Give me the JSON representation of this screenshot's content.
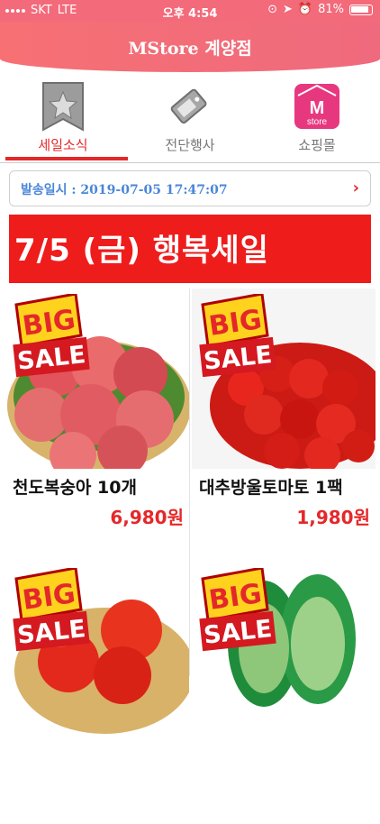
{
  "statusbar": {
    "carrier": "SKT",
    "network": "LTE",
    "time": "오후 4:54",
    "battery": "81%"
  },
  "header": {
    "title": "MStore 계양점"
  },
  "tabs": [
    {
      "label": "세일소식",
      "icon": "star-tag-icon",
      "active": true
    },
    {
      "label": "전단행사",
      "icon": "price-tag-icon",
      "active": false
    },
    {
      "label": "쇼핑몰",
      "icon": "mstore-shop-icon",
      "active": false,
      "icon_text_top": "M",
      "icon_text_bottom": "store"
    }
  ],
  "send_info": {
    "text": "발송일시 : 2019-07-05 17:47:07",
    "chevron": "›"
  },
  "banner": {
    "text": "7/5 (금) 행복세일"
  },
  "badge": {
    "line1": "BIG",
    "line2": "SALE"
  },
  "products": [
    {
      "name": "천도복숭아 10개",
      "price": "6,980원"
    },
    {
      "name": "대추방울토마토 1팩",
      "price": "1,980원"
    },
    {
      "name": "",
      "price": ""
    },
    {
      "name": "",
      "price": ""
    }
  ],
  "colors": {
    "accent": "#e4282a",
    "header": "#f36a7a",
    "link": "#4a86d8"
  }
}
